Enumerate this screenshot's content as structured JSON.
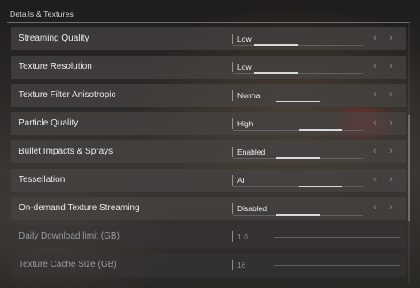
{
  "section": {
    "title": "Details & Textures"
  },
  "rows": [
    {
      "label": "Streaming Quality",
      "value": "Low",
      "level": 0.33,
      "left_arrow": "‹",
      "right_arrow": "›"
    },
    {
      "label": "Texture Resolution",
      "value": "Low",
      "level": 0.33,
      "left_arrow": "‹",
      "right_arrow": "›"
    },
    {
      "label": "Texture Filter Anisotropic",
      "value": "Normal",
      "level": 0.5,
      "left_arrow": "‹",
      "right_arrow": "›"
    },
    {
      "label": "Particle Quality",
      "value": "High",
      "level": 0.67,
      "left_arrow": "‹",
      "right_arrow": "›"
    },
    {
      "label": "Bullet Impacts & Sprays",
      "value": "Enabled",
      "level": 0.5,
      "left_arrow": "‹",
      "right_arrow": "›"
    },
    {
      "label": "Tessellation",
      "value": "All",
      "level": 0.67,
      "left_arrow": "‹",
      "right_arrow": "›"
    },
    {
      "label": "On-demand Texture Streaming",
      "value": "Disabled",
      "level": 0.5,
      "left_arrow": "‹",
      "right_arrow": "›"
    },
    {
      "label": "Daily Download limit (GB)",
      "value": "1.0"
    },
    {
      "label": "Texture Cache Size (GB)",
      "value": "16"
    }
  ]
}
